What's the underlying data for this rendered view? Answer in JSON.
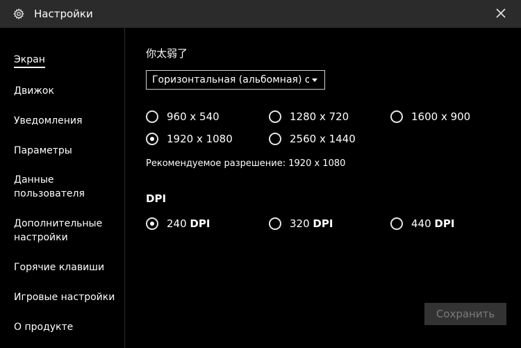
{
  "window": {
    "title": "Настройки",
    "icon": "gear-icon",
    "close_icon": "close-icon"
  },
  "sidebar": {
    "items": [
      {
        "label": "Экран",
        "active": true
      },
      {
        "label": "Движок"
      },
      {
        "label": "Уведомления"
      },
      {
        "label": "Параметры"
      },
      {
        "label": "Данные\nпользователя"
      },
      {
        "label": "Дополнительные\nнастройки"
      },
      {
        "label": "Горячие клавиши"
      },
      {
        "label": "Игровые настройки"
      },
      {
        "label": "О продукте"
      }
    ]
  },
  "main": {
    "heading": "你太弱了",
    "orientation_select": {
      "value": "Горизонтальная (альбомная) ори"
    },
    "resolutions": [
      {
        "label": "960 x 540",
        "checked": false
      },
      {
        "label": "1280 x 720",
        "checked": false
      },
      {
        "label": "1600 x 900",
        "checked": false
      },
      {
        "label": "1920 x 1080",
        "checked": true
      },
      {
        "label": "2560 x 1440",
        "checked": false
      }
    ],
    "recommended_note": "Рекомендуемое разрешение: 1920 x 1080",
    "dpi_title": "DPI",
    "dpi_options": [
      {
        "value": "240",
        "unit": "DPI",
        "checked": true
      },
      {
        "value": "320",
        "unit": "DPI",
        "checked": false
      },
      {
        "value": "440",
        "unit": "DPI",
        "checked": false
      }
    ],
    "save_label": "Сохранить"
  },
  "colors": {
    "titlebar": "#2b2b2b",
    "background": "#000000",
    "save_bg": "#333333",
    "save_text": "#7a7a7a"
  }
}
